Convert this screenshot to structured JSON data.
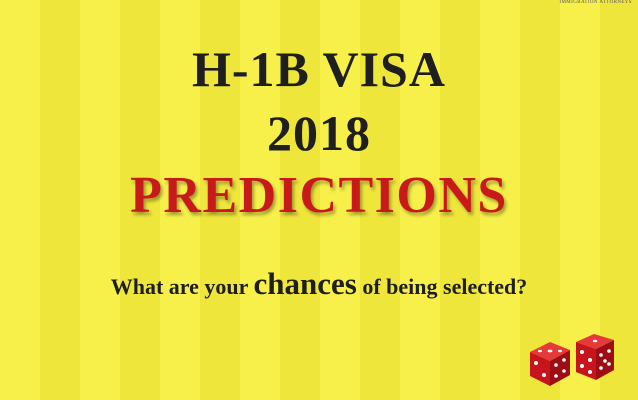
{
  "colors": {
    "background": "#f5ee45",
    "title_text": "#1f1f1f",
    "predictions_text": "#c81a1a",
    "dice_red": "#c8141c"
  },
  "header": {
    "corner_text": "IMMIGRATION ATTORNEYS"
  },
  "title": {
    "line1": "H-1B VISA",
    "line2": "2018",
    "line3": "PREDICTIONS"
  },
  "subtitle": {
    "part1": "What are your ",
    "emphasis": "chances",
    "part2": " of being selected?"
  },
  "icons": {
    "dice": "dice-icon"
  }
}
